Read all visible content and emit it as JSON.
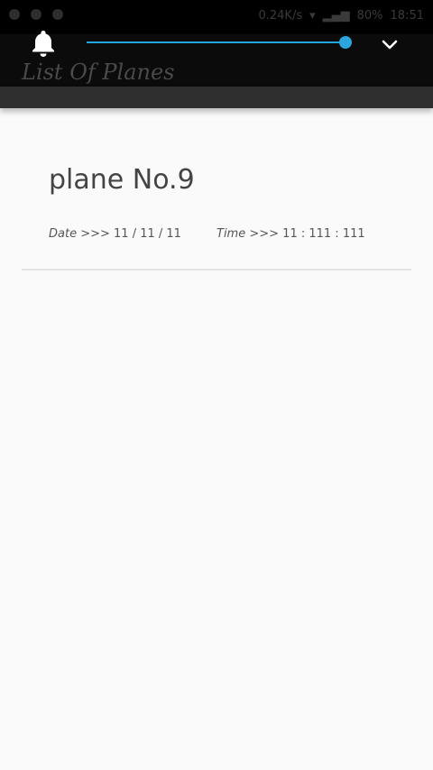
{
  "status": {
    "network_speed": "0.24K/s",
    "battery": "80%",
    "time": "18:51"
  },
  "app": {
    "title": "List Of Planes"
  },
  "volume": {
    "level": 0.99
  },
  "list": [
    {
      "title": "plane No.9",
      "date_label": "Date >>>",
      "date_value": "11 / 11 / 11",
      "time_label": "Time >>>",
      "time_value": "11 : 111 : 111"
    }
  ],
  "colors": {
    "accent": "#23a4da",
    "appbar_bg": "#0b0b0b",
    "content_bg": "#fafafa"
  },
  "icons": [
    "bell-icon",
    "chevron-down-icon"
  ]
}
